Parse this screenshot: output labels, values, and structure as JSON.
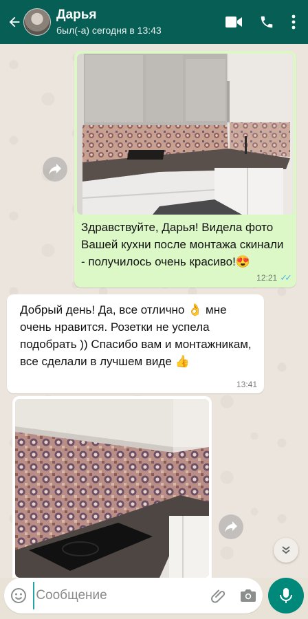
{
  "header": {
    "contact_name": "Дарья",
    "status": "был(-а) сегодня в 13:43",
    "bg_color": "#075e54"
  },
  "icons": {
    "back": "back-arrow-icon",
    "video": "video-call-icon",
    "call": "phone-icon",
    "menu": "more-vert-icon",
    "forward": "forward-icon",
    "scroll": "chevron-down-icon",
    "emoji": "emoji-icon",
    "attach": "attach-icon",
    "camera": "camera-icon",
    "mic": "mic-icon"
  },
  "messages": [
    {
      "direction": "outgoing",
      "has_image": true,
      "text": "Здравствуйте, Дарья! Видела фото Вашей кухни после монтажа скинали - получилось очень красиво!😍",
      "time": "12:21",
      "read": true
    },
    {
      "direction": "incoming",
      "has_image": false,
      "text": "Добрый день! Да, все отлично 👌 мне очень нравится. Розетки не успела подобрать )) Спасибо вам и монтажникам, все сделали в лучшем виде 👍",
      "time": "13:41"
    },
    {
      "direction": "incoming",
      "has_image": true,
      "text": ""
    }
  ],
  "composer": {
    "placeholder": "Сообщение"
  },
  "colors": {
    "outgoing_bubble": "#dcf8c6",
    "incoming_bubble": "#ffffff",
    "read_ticks": "#4fb6ec",
    "mic_button": "#00897b"
  }
}
